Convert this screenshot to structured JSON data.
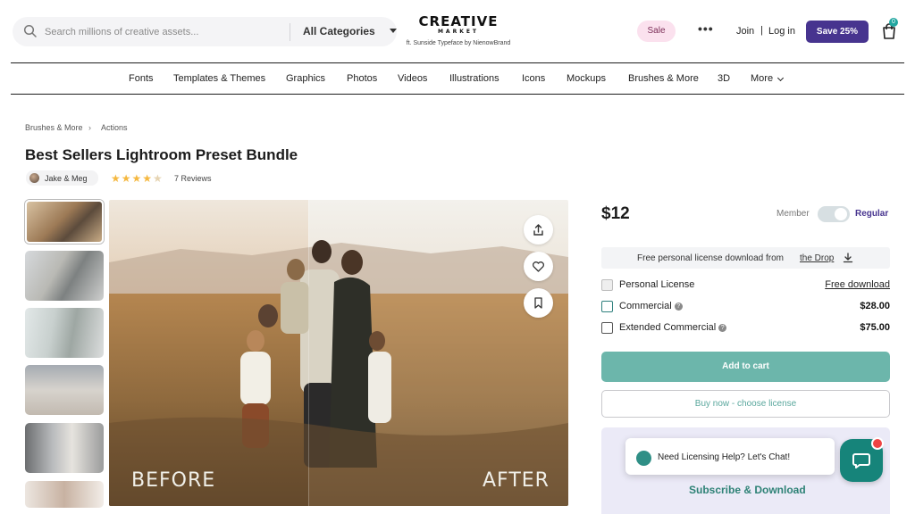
{
  "header": {
    "search_placeholder": "Search millions of creative assets...",
    "category": "All Categories",
    "logo_line1": "CREATIVE",
    "logo_line2": "MARKET",
    "logo_sub": "ft. Sunside Typeface by NienowBrand",
    "sale": "Sale",
    "more_dots": "•••",
    "join": "Join",
    "separator": "|",
    "login": "Log in",
    "save": "Save 25%",
    "cart_count": "0"
  },
  "nav": {
    "items": [
      "Fonts",
      "Templates & Themes",
      "Graphics",
      "Photos",
      "Videos",
      "Illustrations",
      "Icons",
      "Mockups",
      "Brushes & More",
      "3D",
      "More"
    ]
  },
  "breadcrumb": {
    "items": [
      "Brushes & More",
      "Actions"
    ],
    "separator": "›"
  },
  "product": {
    "title": "Best Sellers Lightroom Preset Bundle",
    "author": "Jake & Meg",
    "rating_stars": "★★★★",
    "rating_dim": "★",
    "reviews": "7 Reviews",
    "rating": 4.5,
    "before_label": "BEFORE",
    "after_label": "AFTER"
  },
  "purchase": {
    "price": "$12",
    "member_label": "Member",
    "regular_label": "Regular",
    "free_text": "Free personal license download from",
    "free_link": "the Drop",
    "licenses": [
      {
        "label": "Personal License",
        "price": "Free download",
        "info": ""
      },
      {
        "label": "Commercial",
        "price": "$28.00",
        "info": "?"
      },
      {
        "label": "Extended Commercial",
        "price": "$75.00",
        "info": "?"
      }
    ],
    "add_to_cart": "Add to cart",
    "buy_now": "Buy now - choose license",
    "chat_text": "Need Licensing Help? Let's Chat!",
    "subscribe": "Subscribe & Download"
  },
  "colors": {
    "brand_purple": "#47348f",
    "teal_button": "#6cb6ab",
    "chat_teal": "#16847a",
    "sale_pink": "#fbe1ee"
  },
  "icons": {
    "search": "search-icon",
    "cart": "shopping-bag-icon",
    "share": "share-icon",
    "heart": "heart-icon",
    "bookmark": "bookmark-icon",
    "download": "download-icon",
    "chat": "chat-icon"
  }
}
